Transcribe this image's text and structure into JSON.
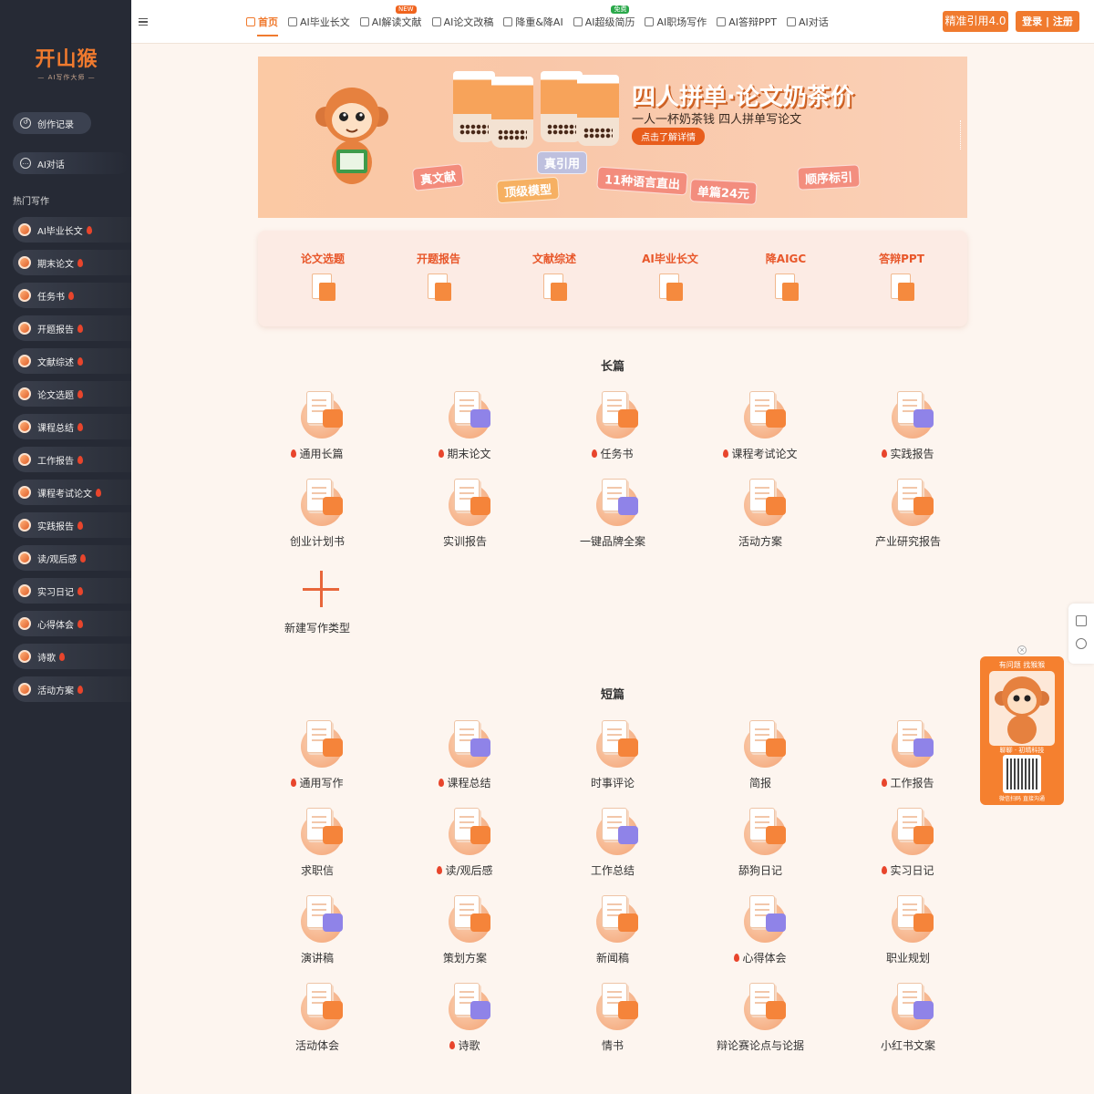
{
  "sidebar": {
    "logo": "开山猴",
    "logo_sub": "— AI写作大师 —",
    "history_label": "创作记录",
    "chat_label": "AI对话",
    "heading": "热门写作",
    "items": [
      {
        "label": "AI毕业长文",
        "hot": true
      },
      {
        "label": "期末论文",
        "hot": true
      },
      {
        "label": "任务书",
        "hot": true
      },
      {
        "label": "开题报告",
        "hot": true
      },
      {
        "label": "文献综述",
        "hot": true
      },
      {
        "label": "论文选题",
        "hot": true
      },
      {
        "label": "课程总结",
        "hot": true
      },
      {
        "label": "工作报告",
        "hot": true
      },
      {
        "label": "课程考试论文",
        "hot": true
      },
      {
        "label": "实践报告",
        "hot": true
      },
      {
        "label": "读/观后感",
        "hot": true
      },
      {
        "label": "实习日记",
        "hot": true
      },
      {
        "label": "心得体会",
        "hot": true
      },
      {
        "label": "诗歌",
        "hot": true
      },
      {
        "label": "活动方案",
        "hot": true
      }
    ]
  },
  "nav": {
    "items": [
      {
        "label": "首页",
        "active": true
      },
      {
        "label": "AI毕业长文"
      },
      {
        "label": "AI解读文献",
        "badge": "NEW",
        "badge_color": "#f0641e"
      },
      {
        "label": "AI论文改稿"
      },
      {
        "label": "降重&降AI"
      },
      {
        "label": "AI超级简历",
        "badge": "免费",
        "badge_color": "#2aa84a"
      },
      {
        "label": "AI职场写作"
      },
      {
        "label": "AI答辩PPT"
      },
      {
        "label": "AI对话"
      }
    ],
    "cite_button": "精准引用4.0",
    "login_button": "登录 | 注册"
  },
  "banner": {
    "title": "四人拼单·论文奶茶价",
    "subtitle": "一人一杯奶茶钱 四人拼单写论文",
    "cta": "点击了解详情",
    "tags": [
      "真文献",
      "真引用",
      "顶级模型",
      "11种语言直出",
      "单篇24元",
      "顺序标引"
    ]
  },
  "quick": [
    {
      "label": "论文选题"
    },
    {
      "label": "开题报告"
    },
    {
      "label": "文献综述"
    },
    {
      "label": "AI毕业长文"
    },
    {
      "label": "降AIGC"
    },
    {
      "label": "答辩PPT"
    }
  ],
  "long_section": {
    "title": "长篇",
    "cards": [
      {
        "label": "通用长篇",
        "hot": true
      },
      {
        "label": "期末论文",
        "hot": true
      },
      {
        "label": "任务书",
        "hot": true
      },
      {
        "label": "课程考试论文",
        "hot": true
      },
      {
        "label": "实践报告",
        "hot": true
      },
      {
        "label": "创业计划书"
      },
      {
        "label": "实训报告"
      },
      {
        "label": "一键品牌全案"
      },
      {
        "label": "活动方案"
      },
      {
        "label": "产业研究报告"
      }
    ],
    "new_type_label": "新建写作类型"
  },
  "short_section": {
    "title": "短篇",
    "cards": [
      {
        "label": "通用写作",
        "hot": true
      },
      {
        "label": "课程总结",
        "hot": true
      },
      {
        "label": "时事评论"
      },
      {
        "label": "简报"
      },
      {
        "label": "工作报告",
        "hot": true
      },
      {
        "label": "求职信"
      },
      {
        "label": "读/观后感",
        "hot": true
      },
      {
        "label": "工作总结"
      },
      {
        "label": "舔狗日记"
      },
      {
        "label": "实习日记",
        "hot": true
      },
      {
        "label": "演讲稿"
      },
      {
        "label": "策划方案"
      },
      {
        "label": "新闻稿"
      },
      {
        "label": "心得体会",
        "hot": true
      },
      {
        "label": "职业规划"
      },
      {
        "label": "活动体会"
      },
      {
        "label": "诗歌",
        "hot": true
      },
      {
        "label": "情书"
      },
      {
        "label": "辩论赛论点与论据"
      },
      {
        "label": "小红书文案"
      }
    ]
  },
  "helper": {
    "title": "有问题 找猴猴",
    "left": "聊聊",
    "right": "初晴科技",
    "foot": "微信扫码 直接沟通"
  },
  "colors": {
    "accent": "#f07a2e",
    "sidebar": "#262a35",
    "page": "#fdf5ef"
  }
}
